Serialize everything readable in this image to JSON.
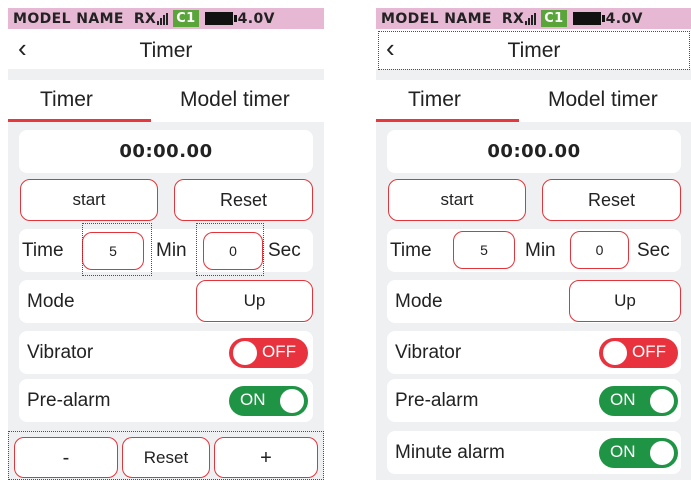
{
  "status_bar": {
    "model_name": "MODEL NAME",
    "rx": "RX",
    "channel": "C1",
    "voltage": "4.0V"
  },
  "header": {
    "back_icon": "chevron-left",
    "title": "Timer"
  },
  "tabs": [
    {
      "label": "Timer",
      "active": true
    },
    {
      "label": "Model timer",
      "active": false
    }
  ],
  "timer": {
    "display": "00:00.00",
    "start_label": "start",
    "reset_label": "Reset"
  },
  "time_row": {
    "label": "Time",
    "minutes": "5",
    "min_unit": "Min",
    "seconds": "0",
    "sec_unit": "Sec"
  },
  "mode_row": {
    "label": "Mode",
    "value": "Up"
  },
  "vibrator_row": {
    "label": "Vibrator",
    "state": "OFF"
  },
  "prealarm_row": {
    "label": "Pre-alarm",
    "state": "ON"
  },
  "minute_alarm_row": {
    "label": "Minute alarm",
    "state": "ON"
  },
  "stepper": {
    "minus_label": "-",
    "reset_label": "Reset",
    "plus_label": "+"
  },
  "colors": {
    "accent_red": "#e2343b",
    "toggle_on": "#1f9444",
    "toggle_off": "#e8333f",
    "status_bar": "#e7b8d3",
    "focus_outline": "#2a4fb0"
  }
}
